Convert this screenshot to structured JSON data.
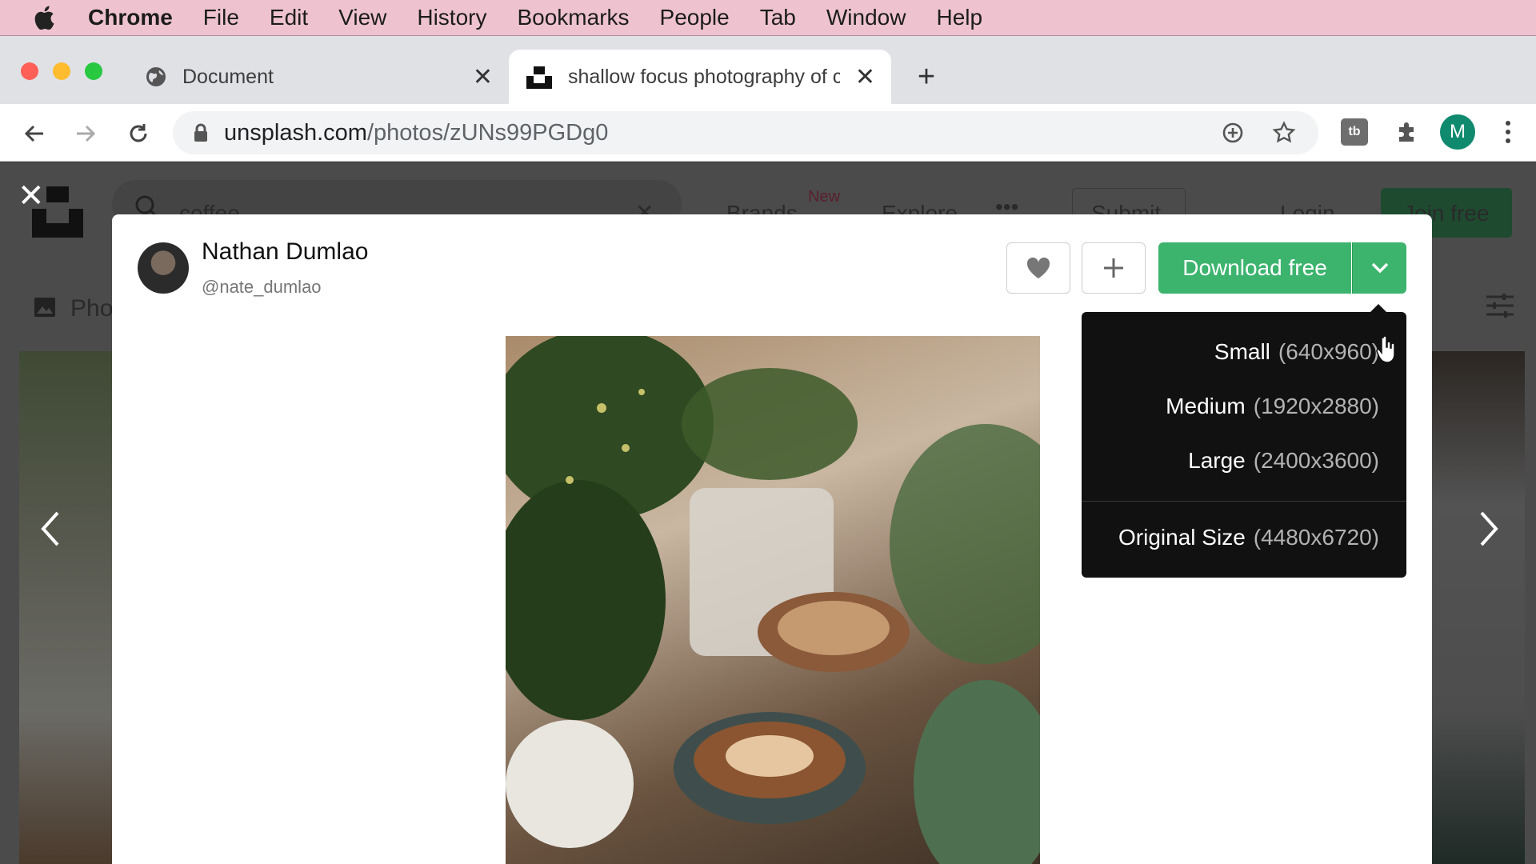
{
  "menubar": {
    "app": "Chrome",
    "items": [
      "File",
      "Edit",
      "View",
      "History",
      "Bookmarks",
      "People",
      "Tab",
      "Window",
      "Help"
    ]
  },
  "tabs": [
    {
      "label": "Document",
      "icon": "globe-icon"
    },
    {
      "label": "shallow focus photography of c",
      "icon": "unsplash-icon"
    }
  ],
  "toolbar": {
    "url_host": "unsplash.com",
    "url_path": "/photos/zUNs99PGDg0",
    "profile_initial": "M"
  },
  "background_page": {
    "search_value": "coffee",
    "nav": [
      "Brands",
      "Explore",
      "Submit",
      "Login",
      "Join free"
    ],
    "new_badge": "New",
    "tab_label": "Pho"
  },
  "modal": {
    "author_name": "Nathan Dumlao",
    "author_handle": "@nate_dumlao",
    "download_label": "Download free"
  },
  "dropdown": {
    "items": [
      {
        "label": "Small",
        "size": "(640x960)"
      },
      {
        "label": "Medium",
        "size": "(1920x2880)"
      },
      {
        "label": "Large",
        "size": "(2400x3600)"
      },
      {
        "label": "Original Size",
        "size": "(4480x6720)"
      }
    ]
  },
  "colors": {
    "accent_green": "#3cb46e",
    "menubar": "#eec3cf",
    "profile": "#0f8a6e"
  }
}
